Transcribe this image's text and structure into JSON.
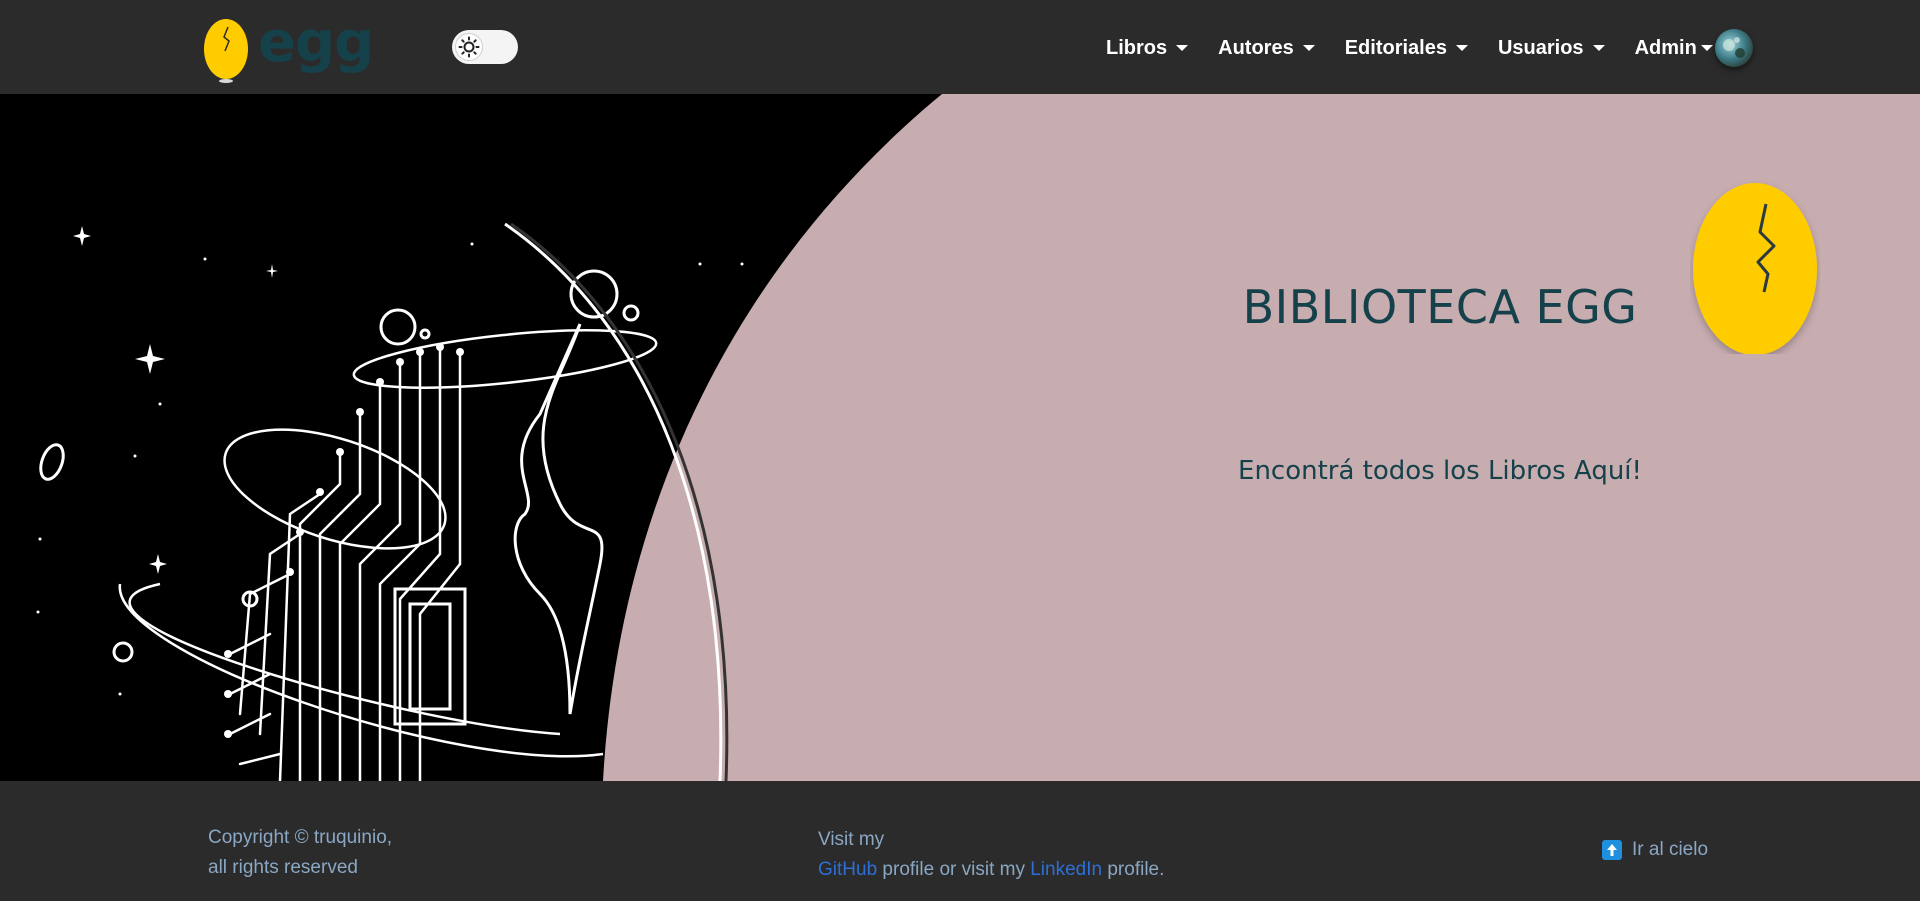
{
  "navbar": {
    "brand": "egg",
    "menu": [
      {
        "label": "Libros"
      },
      {
        "label": "Autores"
      },
      {
        "label": "Editoriales"
      },
      {
        "label": "Usuarios"
      },
      {
        "label": "Admin"
      }
    ],
    "theme_toggle_icon": "sun-icon"
  },
  "hero": {
    "title": "BIBLIOTECA EGG",
    "subtitle": "Encontrá todos los Libros Aquí!"
  },
  "footer": {
    "copyright_line1": "Copyright © truquinio,",
    "copyright_line2": "all rights reserved",
    "visit_line": "Visit my",
    "github_link": "GitHub",
    "middle_text": " profile or visit my ",
    "linkedin_link": "LinkedIn",
    "end_text": " profile.",
    "back_to_top": "Ir al cielo"
  },
  "colors": {
    "navbar_bg": "#2b2b2b",
    "hero_bg": "#c8adb0",
    "brand_text": "#15414a",
    "egg_yellow": "#ffcc00",
    "link_blue": "#2d6fd6",
    "footer_text": "#8aa7c4"
  }
}
